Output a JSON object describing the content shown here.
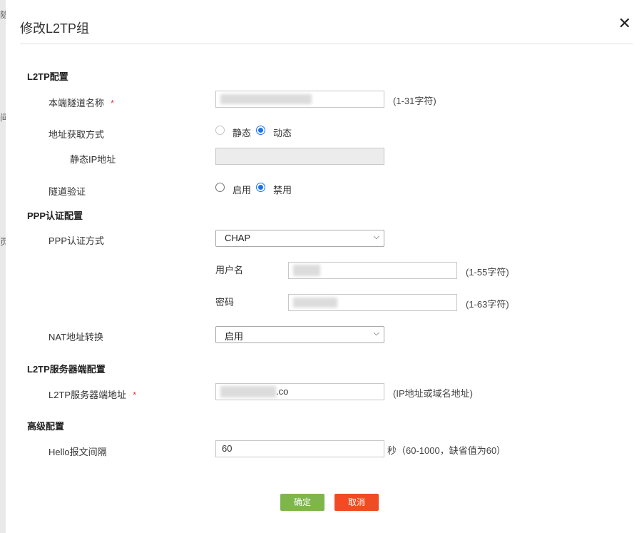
{
  "dialog": {
    "title": "修改L2TP组",
    "close": "✕"
  },
  "l2tp": {
    "section": "L2TP配置",
    "tunnel_name_label": "本端隧道名称",
    "tunnel_name_hint": "(1-31字符)",
    "addr_mode_label": "地址获取方式",
    "addr_static": "静态",
    "addr_dynamic": "动态",
    "static_ip_label": "静态IP地址",
    "tunnel_auth_label": "隧道验证",
    "auth_enable": "启用",
    "auth_disable": "禁用",
    "required_mark": "*"
  },
  "ppp": {
    "section": "PPP认证配置",
    "auth_mode_label": "PPP认证方式",
    "auth_mode_value": "CHAP",
    "username_label": "用户名",
    "username_hint": "(1-55字符)",
    "password_label": "密码",
    "password_hint": "(1-63字符)",
    "nat_label": "NAT地址转换",
    "nat_value": "启用"
  },
  "server": {
    "section": "L2TP服务器端配置",
    "addr_label": "L2TP服务器端地址",
    "addr_value_suffix": ".co",
    "addr_hint": "(IP地址或域名地址)"
  },
  "advanced": {
    "section": "高级配置",
    "hello_label": "Hello报文间隔",
    "hello_value": "60",
    "hello_hint": "秒（60-1000，缺省值为60）"
  },
  "buttons": {
    "ok": "确定",
    "cancel": "取消"
  },
  "background": {
    "fragments": [
      "隧",
      "间",
      "页"
    ]
  },
  "colors": {
    "ok": "#7fb64c",
    "cancel": "#f04b23",
    "radio": "#1a73e8",
    "required": "#e4393c"
  }
}
